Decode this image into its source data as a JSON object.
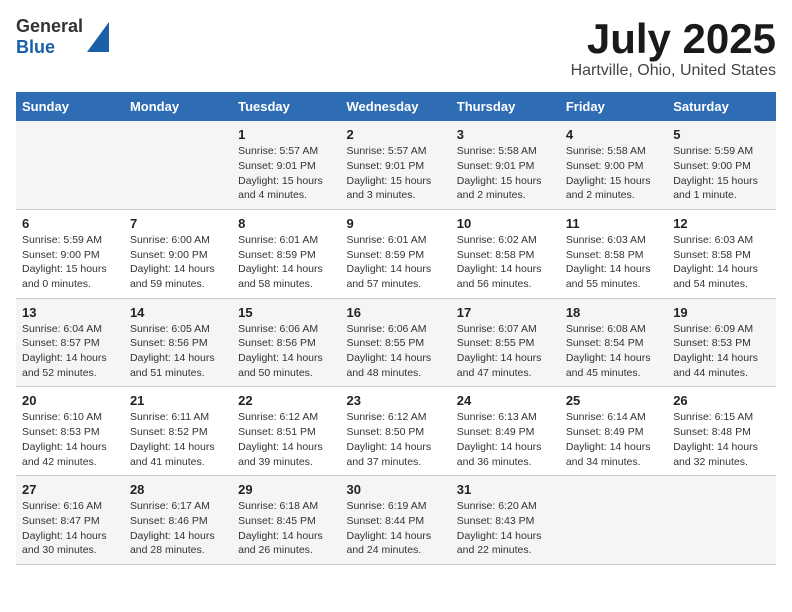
{
  "header": {
    "logo_line1": "General",
    "logo_line2": "Blue",
    "title": "July 2025",
    "subtitle": "Hartville, Ohio, United States"
  },
  "columns": [
    "Sunday",
    "Monday",
    "Tuesday",
    "Wednesday",
    "Thursday",
    "Friday",
    "Saturday"
  ],
  "weeks": [
    [
      {
        "day": "",
        "info": ""
      },
      {
        "day": "",
        "info": ""
      },
      {
        "day": "1",
        "info": "Sunrise: 5:57 AM\nSunset: 9:01 PM\nDaylight: 15 hours and 4 minutes."
      },
      {
        "day": "2",
        "info": "Sunrise: 5:57 AM\nSunset: 9:01 PM\nDaylight: 15 hours and 3 minutes."
      },
      {
        "day": "3",
        "info": "Sunrise: 5:58 AM\nSunset: 9:01 PM\nDaylight: 15 hours and 2 minutes."
      },
      {
        "day": "4",
        "info": "Sunrise: 5:58 AM\nSunset: 9:00 PM\nDaylight: 15 hours and 2 minutes."
      },
      {
        "day": "5",
        "info": "Sunrise: 5:59 AM\nSunset: 9:00 PM\nDaylight: 15 hours and 1 minute."
      }
    ],
    [
      {
        "day": "6",
        "info": "Sunrise: 5:59 AM\nSunset: 9:00 PM\nDaylight: 15 hours and 0 minutes."
      },
      {
        "day": "7",
        "info": "Sunrise: 6:00 AM\nSunset: 9:00 PM\nDaylight: 14 hours and 59 minutes."
      },
      {
        "day": "8",
        "info": "Sunrise: 6:01 AM\nSunset: 8:59 PM\nDaylight: 14 hours and 58 minutes."
      },
      {
        "day": "9",
        "info": "Sunrise: 6:01 AM\nSunset: 8:59 PM\nDaylight: 14 hours and 57 minutes."
      },
      {
        "day": "10",
        "info": "Sunrise: 6:02 AM\nSunset: 8:58 PM\nDaylight: 14 hours and 56 minutes."
      },
      {
        "day": "11",
        "info": "Sunrise: 6:03 AM\nSunset: 8:58 PM\nDaylight: 14 hours and 55 minutes."
      },
      {
        "day": "12",
        "info": "Sunrise: 6:03 AM\nSunset: 8:58 PM\nDaylight: 14 hours and 54 minutes."
      }
    ],
    [
      {
        "day": "13",
        "info": "Sunrise: 6:04 AM\nSunset: 8:57 PM\nDaylight: 14 hours and 52 minutes."
      },
      {
        "day": "14",
        "info": "Sunrise: 6:05 AM\nSunset: 8:56 PM\nDaylight: 14 hours and 51 minutes."
      },
      {
        "day": "15",
        "info": "Sunrise: 6:06 AM\nSunset: 8:56 PM\nDaylight: 14 hours and 50 minutes."
      },
      {
        "day": "16",
        "info": "Sunrise: 6:06 AM\nSunset: 8:55 PM\nDaylight: 14 hours and 48 minutes."
      },
      {
        "day": "17",
        "info": "Sunrise: 6:07 AM\nSunset: 8:55 PM\nDaylight: 14 hours and 47 minutes."
      },
      {
        "day": "18",
        "info": "Sunrise: 6:08 AM\nSunset: 8:54 PM\nDaylight: 14 hours and 45 minutes."
      },
      {
        "day": "19",
        "info": "Sunrise: 6:09 AM\nSunset: 8:53 PM\nDaylight: 14 hours and 44 minutes."
      }
    ],
    [
      {
        "day": "20",
        "info": "Sunrise: 6:10 AM\nSunset: 8:53 PM\nDaylight: 14 hours and 42 minutes."
      },
      {
        "day": "21",
        "info": "Sunrise: 6:11 AM\nSunset: 8:52 PM\nDaylight: 14 hours and 41 minutes."
      },
      {
        "day": "22",
        "info": "Sunrise: 6:12 AM\nSunset: 8:51 PM\nDaylight: 14 hours and 39 minutes."
      },
      {
        "day": "23",
        "info": "Sunrise: 6:12 AM\nSunset: 8:50 PM\nDaylight: 14 hours and 37 minutes."
      },
      {
        "day": "24",
        "info": "Sunrise: 6:13 AM\nSunset: 8:49 PM\nDaylight: 14 hours and 36 minutes."
      },
      {
        "day": "25",
        "info": "Sunrise: 6:14 AM\nSunset: 8:49 PM\nDaylight: 14 hours and 34 minutes."
      },
      {
        "day": "26",
        "info": "Sunrise: 6:15 AM\nSunset: 8:48 PM\nDaylight: 14 hours and 32 minutes."
      }
    ],
    [
      {
        "day": "27",
        "info": "Sunrise: 6:16 AM\nSunset: 8:47 PM\nDaylight: 14 hours and 30 minutes."
      },
      {
        "day": "28",
        "info": "Sunrise: 6:17 AM\nSunset: 8:46 PM\nDaylight: 14 hours and 28 minutes."
      },
      {
        "day": "29",
        "info": "Sunrise: 6:18 AM\nSunset: 8:45 PM\nDaylight: 14 hours and 26 minutes."
      },
      {
        "day": "30",
        "info": "Sunrise: 6:19 AM\nSunset: 8:44 PM\nDaylight: 14 hours and 24 minutes."
      },
      {
        "day": "31",
        "info": "Sunrise: 6:20 AM\nSunset: 8:43 PM\nDaylight: 14 hours and 22 minutes."
      },
      {
        "day": "",
        "info": ""
      },
      {
        "day": "",
        "info": ""
      }
    ]
  ]
}
